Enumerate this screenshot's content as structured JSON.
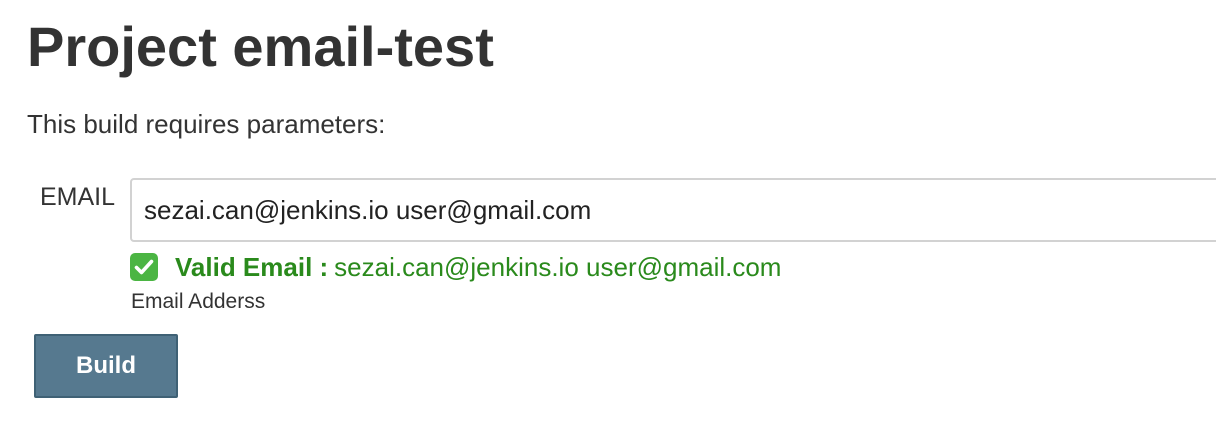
{
  "page": {
    "title": "Project email-test",
    "intro": "This build requires parameters:"
  },
  "parameter": {
    "label": "EMAIL",
    "value": "sezai.can@jenkins.io user@gmail.com",
    "validation": {
      "icon": "check-icon",
      "prefix": "Valid Email :",
      "emails": "sezai.can@jenkins.io user@gmail.com",
      "color": "#2a8a1c"
    },
    "help": "Email Adderss"
  },
  "actions": {
    "build_label": "Build",
    "build_color": "#56798f"
  }
}
